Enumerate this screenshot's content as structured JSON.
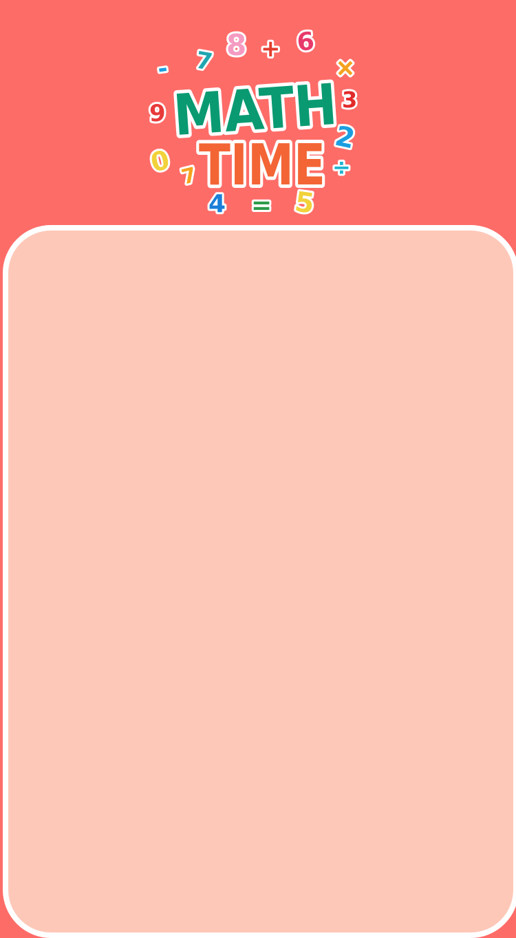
{
  "colors": {
    "background": "#fe6c68",
    "panel": "#fec8b8",
    "panel_border": "#ffffff",
    "math_word": "#0a9a72",
    "time_word": "#f36535"
  },
  "logo": {
    "line1": "MATH",
    "line2": "TIME",
    "symbols": [
      "-",
      "7",
      "8",
      "+",
      "6",
      "+",
      "9",
      "3",
      "2",
      "0",
      "7",
      "÷",
      "4",
      "=",
      "5"
    ]
  },
  "panel": {
    "content": []
  }
}
